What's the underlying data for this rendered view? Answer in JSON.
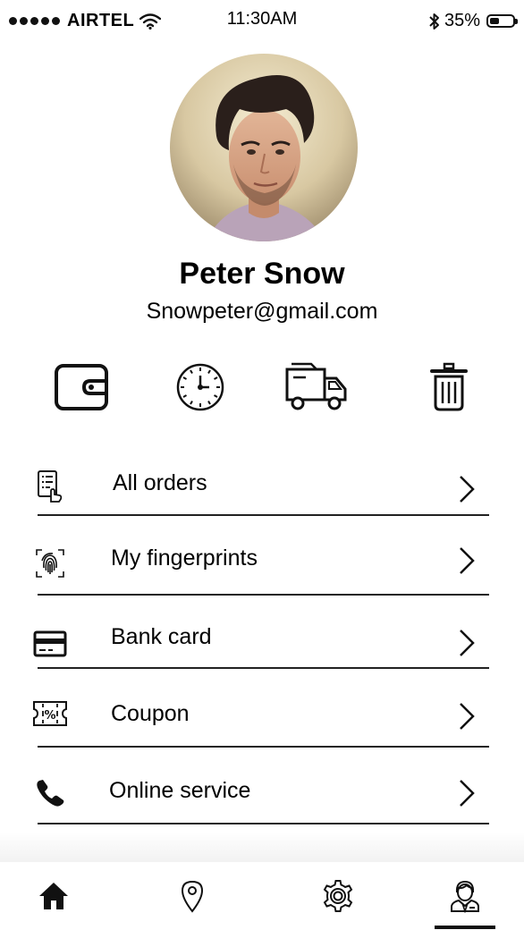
{
  "status_bar": {
    "carrier": "AIRTEL",
    "time": "11:30AM",
    "battery": "35%"
  },
  "profile": {
    "name": "Peter Snow",
    "email": "Snowpeter@gmail.com"
  },
  "quick_actions": [
    {
      "icon": "wallet-icon"
    },
    {
      "icon": "clock-icon"
    },
    {
      "icon": "truck-icon"
    },
    {
      "icon": "trash-icon"
    }
  ],
  "menu": {
    "items": [
      {
        "label": "All orders",
        "icon": "orders-icon"
      },
      {
        "label": "My fingerprints",
        "icon": "fingerprint-icon"
      },
      {
        "label": "Bank card",
        "icon": "bank-card-icon"
      },
      {
        "label": "Coupon",
        "icon": "coupon-icon"
      },
      {
        "label": "Online service",
        "icon": "phone-icon"
      }
    ]
  },
  "tab_bar": {
    "tabs": [
      {
        "icon": "home-icon"
      },
      {
        "icon": "location-icon"
      },
      {
        "icon": "settings-icon"
      },
      {
        "icon": "profile-icon"
      }
    ],
    "active_index": 3
  }
}
